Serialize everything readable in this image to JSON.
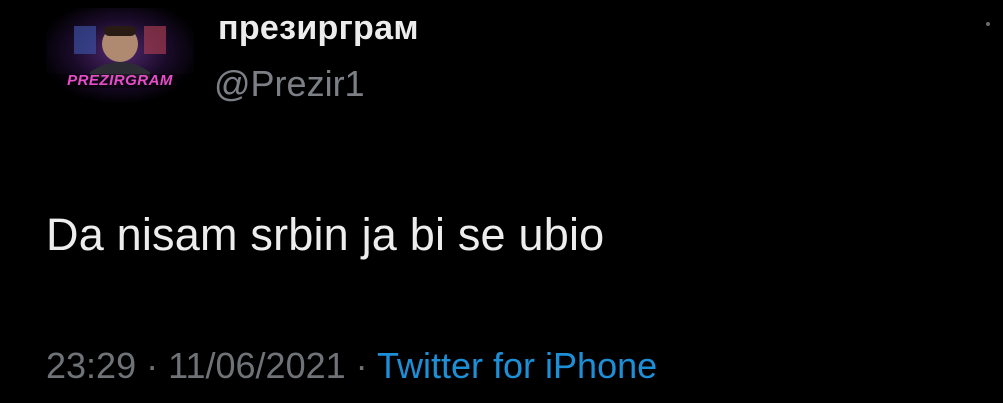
{
  "user": {
    "display_name": "презирграм",
    "handle": "@Prezir1",
    "avatar_logo_text": "PREZIRGRAM"
  },
  "tweet": {
    "text": "Da nisam srbin ja bi se ubio"
  },
  "meta": {
    "time": "23:29",
    "separator": "·",
    "date": "11/06/2021",
    "source": "Twitter for iPhone"
  },
  "colors": {
    "background": "#000000",
    "text": "#ededed",
    "muted": "#6f7378",
    "link": "#1d8fd6"
  },
  "icons": {
    "more": "more-options-icon"
  }
}
